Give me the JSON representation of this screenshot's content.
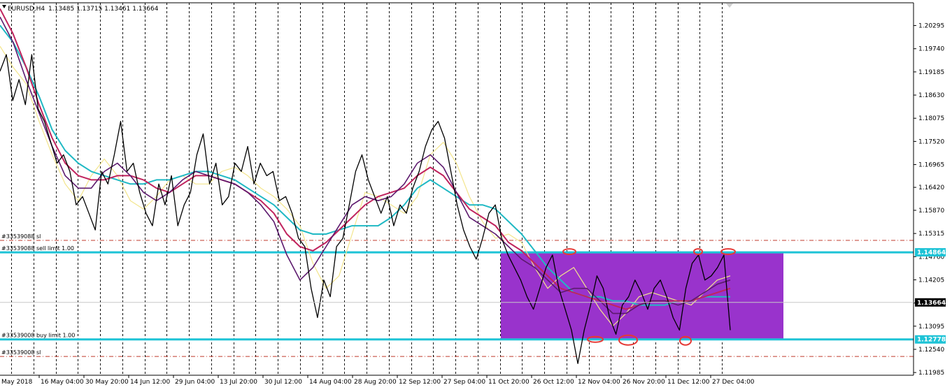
{
  "header": {
    "symbol": "EURUSD,H4",
    "ohlc": "1.13485 1.13715 1.13461 1.13664"
  },
  "colors": {
    "background": "#ffffff",
    "price_line": "#000000",
    "grid": "#000000",
    "ma_fast": "#f3e58c",
    "ma_purple": "#5d1a6e",
    "ma_crimson": "#c0245e",
    "ma_teal": "#20b9c4",
    "zone_fill": "#9933cc",
    "order_line": "#1ec3d6",
    "sl_line": "#c0392b",
    "circle": "#e53935"
  },
  "orders": [
    {
      "label": "#33539088 sl",
      "price": 1.1515,
      "kind": "sl"
    },
    {
      "label": "#33539088 sell limit 1.00",
      "price": 1.14864,
      "kind": "order"
    },
    {
      "label": "#33539008 buy limit 1.00",
      "price": 1.12778,
      "kind": "order"
    },
    {
      "label": "#33539008 sl",
      "price": 1.1237,
      "kind": "sl"
    }
  ],
  "price_tags": {
    "sell": "1.14864",
    "current": "1.13664",
    "buy": "1.12778"
  },
  "chart_data": {
    "type": "line",
    "title": "EURUSD,H4",
    "x_tick_labels": [
      "May 2018",
      "16 May 04:00",
      "30 May 20:00",
      "14 Jun 12:00",
      "29 Jun 04:00",
      "13 Jul 20:00",
      "30 Jul 12:00",
      "14 Aug 04:00",
      "28 Aug 20:00",
      "12 Sep 12:00",
      "27 Sep 04:00",
      "11 Oct 20:00",
      "26 Oct 12:00",
      "12 Nov 04:00",
      "26 Nov 20:00",
      "11 Dec 12:00",
      "27 Dec 04:00"
    ],
    "y_tick_labels": [
      "1.20295",
      "1.19740",
      "1.19185",
      "1.18630",
      "1.18075",
      "1.17520",
      "1.16965",
      "1.16420",
      "1.15870",
      "1.15315",
      "1.14760",
      "1.14205",
      "1.13650",
      "1.13095",
      "1.12540",
      "1.11985"
    ],
    "ylim": [
      1.1192,
      1.2084
    ],
    "grid": "vertical dashed",
    "series": [
      {
        "role": "price",
        "values": [
          1.192,
          1.196,
          1.185,
          1.19,
          1.184,
          1.196,
          1.183,
          1.18,
          1.175,
          1.17,
          1.172,
          1.168,
          1.16,
          1.162,
          1.158,
          1.154,
          1.168,
          1.165,
          1.172,
          1.18,
          1.168,
          1.17,
          1.163,
          1.158,
          1.155,
          1.165,
          1.16,
          1.167,
          1.155,
          1.16,
          1.163,
          1.172,
          1.177,
          1.165,
          1.17,
          1.16,
          1.162,
          1.17,
          1.168,
          1.174,
          1.165,
          1.17,
          1.167,
          1.168,
          1.161,
          1.162,
          1.158,
          1.152,
          1.15,
          1.14,
          1.133,
          1.142,
          1.138,
          1.15,
          1.152,
          1.16,
          1.168,
          1.172,
          1.166,
          1.162,
          1.158,
          1.162,
          1.155,
          1.16,
          1.158,
          1.164,
          1.168,
          1.174,
          1.178,
          1.18,
          1.176,
          1.168,
          1.16,
          1.154,
          1.15,
          1.147,
          1.152,
          1.158,
          1.16,
          1.152,
          1.148,
          1.145,
          1.142,
          1.138,
          1.135,
          1.14,
          1.145,
          1.148,
          1.14,
          1.135,
          1.13,
          1.122,
          1.13,
          1.136,
          1.143,
          1.14,
          1.133,
          1.129,
          1.136,
          1.138,
          1.142,
          1.139,
          1.135,
          1.14,
          1.142,
          1.138,
          1.133,
          1.13,
          1.14,
          1.146,
          1.148,
          1.142,
          1.143,
          1.145,
          1.148,
          1.13
        ]
      },
      {
        "role": "ma-fast",
        "values": [
          1.198,
          1.193,
          1.189,
          1.18,
          1.172,
          1.165,
          1.161,
          1.167,
          1.171,
          1.167,
          1.161,
          1.159,
          1.162,
          1.166,
          1.167,
          1.165,
          1.165,
          1.168,
          1.169,
          1.167,
          1.164,
          1.162,
          1.159,
          1.155,
          1.146,
          1.14,
          1.143,
          1.153,
          1.163,
          1.162,
          1.16,
          1.158,
          1.162,
          1.172,
          1.175,
          1.17,
          1.162,
          1.156,
          1.152,
          1.153,
          1.151,
          1.145,
          1.14,
          1.143,
          1.145,
          1.14,
          1.135,
          1.131,
          1.134,
          1.138,
          1.139,
          1.138,
          1.137,
          1.136,
          1.139,
          1.142,
          1.143
        ]
      },
      {
        "role": "ma-purple",
        "values": [
          1.205,
          1.199,
          1.19,
          1.182,
          1.174,
          1.167,
          1.164,
          1.164,
          1.168,
          1.17,
          1.167,
          1.163,
          1.161,
          1.163,
          1.166,
          1.168,
          1.167,
          1.166,
          1.165,
          1.163,
          1.16,
          1.156,
          1.148,
          1.142,
          1.145,
          1.15,
          1.155,
          1.16,
          1.162,
          1.161,
          1.162,
          1.165,
          1.17,
          1.172,
          1.169,
          1.163,
          1.157,
          1.155,
          1.153,
          1.15,
          1.147,
          1.145,
          1.142,
          1.139,
          1.14,
          1.14,
          1.137,
          1.134,
          1.134,
          1.136,
          1.137,
          1.137,
          1.136,
          1.137,
          1.139,
          1.141,
          1.142
        ]
      },
      {
        "role": "ma-crimson",
        "values": [
          1.207,
          1.201,
          1.193,
          1.184,
          1.176,
          1.17,
          1.167,
          1.166,
          1.166,
          1.167,
          1.167,
          1.166,
          1.164,
          1.163,
          1.165,
          1.167,
          1.167,
          1.166,
          1.165,
          1.163,
          1.161,
          1.158,
          1.153,
          1.15,
          1.149,
          1.151,
          1.154,
          1.157,
          1.16,
          1.162,
          1.163,
          1.164,
          1.167,
          1.169,
          1.167,
          1.163,
          1.159,
          1.157,
          1.155,
          1.151,
          1.149,
          1.146,
          1.143,
          1.14,
          1.139,
          1.138,
          1.137,
          1.136,
          1.135,
          1.136,
          1.137,
          1.137,
          1.137,
          1.137,
          1.138,
          1.139,
          1.14
        ]
      },
      {
        "role": "ma-teal",
        "values": [
          1.203,
          1.199,
          1.193,
          1.186,
          1.178,
          1.173,
          1.17,
          1.168,
          1.167,
          1.166,
          1.165,
          1.165,
          1.166,
          1.166,
          1.167,
          1.168,
          1.168,
          1.167,
          1.166,
          1.164,
          1.162,
          1.16,
          1.157,
          1.154,
          1.153,
          1.153,
          1.154,
          1.155,
          1.155,
          1.155,
          1.157,
          1.16,
          1.164,
          1.166,
          1.164,
          1.162,
          1.16,
          1.16,
          1.159,
          1.156,
          1.153,
          1.149,
          1.145,
          1.142,
          1.139,
          1.138,
          1.138,
          1.137,
          1.137,
          1.136,
          1.136,
          1.136,
          1.137,
          1.137,
          1.138,
          1.138,
          1.138
        ]
      }
    ],
    "zone": {
      "top": 1.14864,
      "bottom": 1.12778
    }
  }
}
